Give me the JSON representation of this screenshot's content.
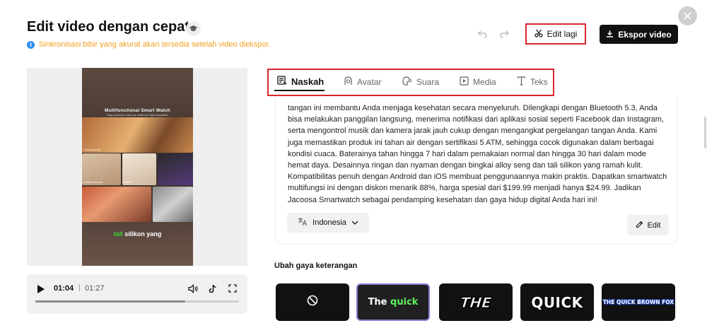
{
  "header": {
    "title": "Edit video dengan cepat",
    "info": "Sinkronisasi bibir yang akurat akan tersedia setelah video diekspor.",
    "edit_again": "Edit lagi",
    "export": "Ekspor video"
  },
  "video": {
    "overlay_title": "Multifunctional Smart Watch",
    "overlay_sub": "Stay connected, track your health and style everywhere",
    "tiles": [
      {
        "label": "Control music"
      },
      {
        "label": ""
      },
      {
        "label": "Control camera"
      },
      {
        "label": "Alarm"
      },
      {
        "label": ""
      },
      {
        "label": ""
      }
    ],
    "caption_highlight": "tali",
    "caption_rest": "silikon yang"
  },
  "player": {
    "current_time": "01:04",
    "separator": "|",
    "total_time": "01:27",
    "progress": 0.736
  },
  "tabs": [
    {
      "label": "Naskah",
      "active": true
    },
    {
      "label": "Avatar",
      "active": false
    },
    {
      "label": "Suara",
      "active": false
    },
    {
      "label": "Media",
      "active": false
    },
    {
      "label": "Teks",
      "active": false
    }
  ],
  "script": {
    "text": "tangan ini membantu Anda menjaga kesehatan secara menyeluruh. Dilengkapi dengan Bluetooth 5.3, Anda bisa melakukan panggilan langsung, menerima notifikasi dari aplikasi sosial seperti Facebook dan Instagram, serta mengontrol musik dan kamera jarak jauh cukup dengan mengangkat pergelangan tangan Anda. Kami juga memastikan produk ini tahan air dengan sertifikasi 5 ATM, sehingga cocok digunakan dalam berbagai kondisi cuaca. Baterainya tahan hingga 7 hari dalam pemakaian normal dan hingga 30 hari dalam mode hemat daya. Desainnya ringan dan nyaman dengan bingkai alloy seng dan tali silikon yang ramah kulit. Kompatibilitas penuh dengan Android dan iOS membuat penggunaannya makin praktis. Dapatkan smartwatch multifungsi ini dengan diskon menarik 88%, harga spesial dari $199.99 menjadi hanya $24.99. Jadikan Jacoosa Smartwatch sebagai pendamping kesehatan dan gaya hidup digital Anda hari ini!",
    "language": "Indonesia",
    "edit_label": "Edit"
  },
  "caption_styles": {
    "heading": "Ubah gaya keterangan",
    "styles": [
      {
        "name": "none",
        "text": ""
      },
      {
        "name": "green-highlight",
        "text_a": "The",
        "text_b": "quick",
        "selected": true
      },
      {
        "name": "italic-outline",
        "text": "THE"
      },
      {
        "name": "bold-shadow",
        "text": "QUICK"
      },
      {
        "name": "blue-outline",
        "text": "THE QUICK BROWN FOX"
      }
    ]
  },
  "colors": {
    "accent_red": "#d9262a",
    "info_orange": "#f0a020",
    "info_blue": "#2d8cf0",
    "highlight_green": "#5ff05f",
    "selected_border": "#8b7bd8"
  }
}
